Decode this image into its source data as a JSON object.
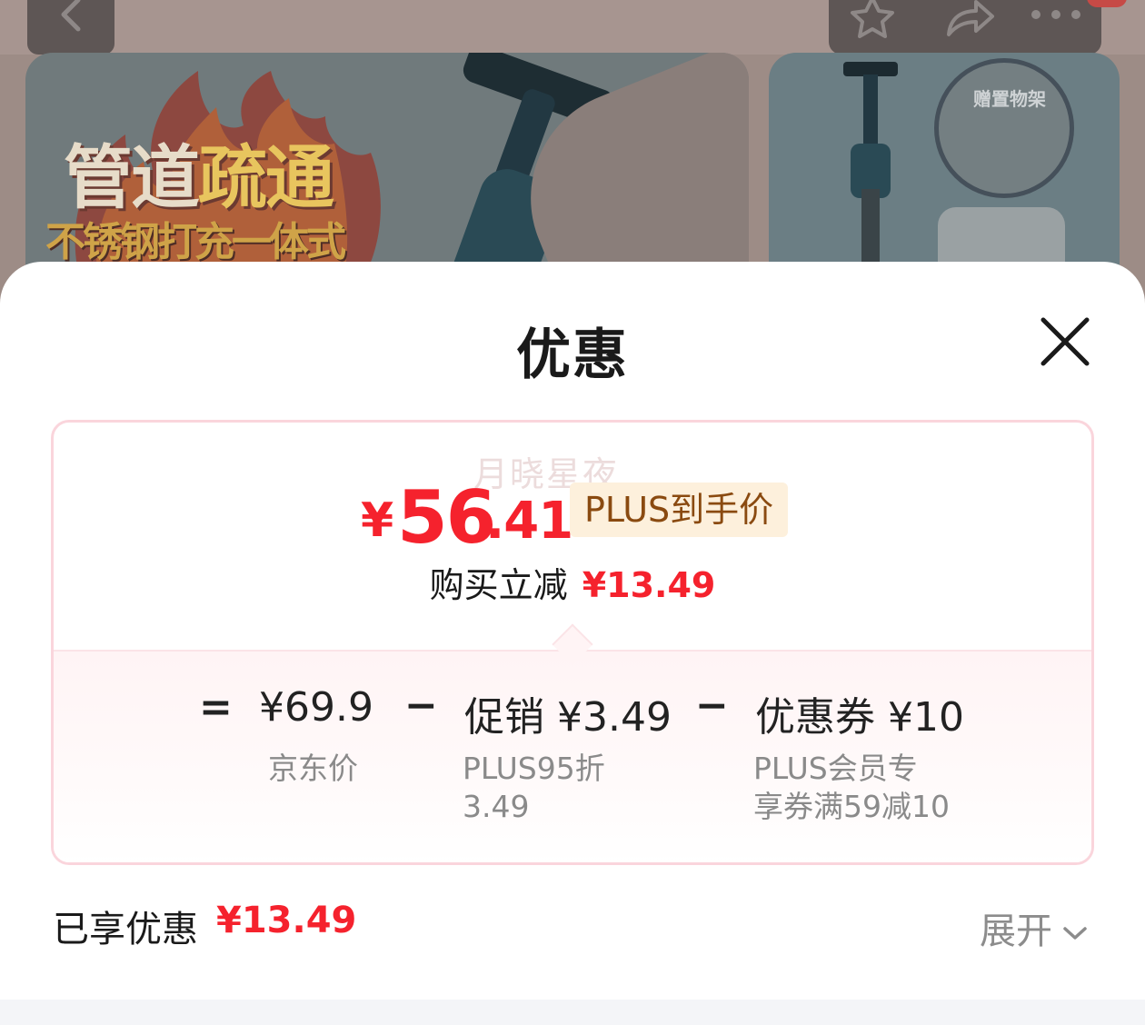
{
  "background": {
    "promo_title_part1": "管道",
    "promo_title_part2": "疏通",
    "promo_subtitle": "不锈钢打充一体式",
    "gift_label": "赠置物架",
    "icons": [
      "back-icon",
      "star-icon",
      "share-icon",
      "more-icon"
    ]
  },
  "sheet": {
    "title": "优惠",
    "close_icon": "close-icon",
    "watermark": "月晓星夜",
    "price": {
      "currency": "¥",
      "integer": "56",
      "decimal": ".41",
      "tag": "PLUS到手价"
    },
    "instant": {
      "label": "购买立减",
      "value": "¥13.49"
    },
    "formula": {
      "eq": "=",
      "minus": "−",
      "jd_price": "¥69.9",
      "jd_price_label": "京东价",
      "promo": "促销 ¥3.49",
      "promo_note_line1": "PLUS95折",
      "promo_note_line2": "3.49",
      "coupon": "优惠券 ¥10",
      "coupon_note_line1": "PLUS会员专",
      "coupon_note_line2": "享券满59减10"
    },
    "enjoyed": {
      "label": "已享优惠",
      "value": "¥13.49"
    },
    "expand_label": "展开"
  },
  "colors": {
    "accent_red": "#f5222d",
    "plus_tag_bg": "#fdf0dc",
    "plus_tag_text": "#8a4a10",
    "card_border": "#fad5dc"
  }
}
